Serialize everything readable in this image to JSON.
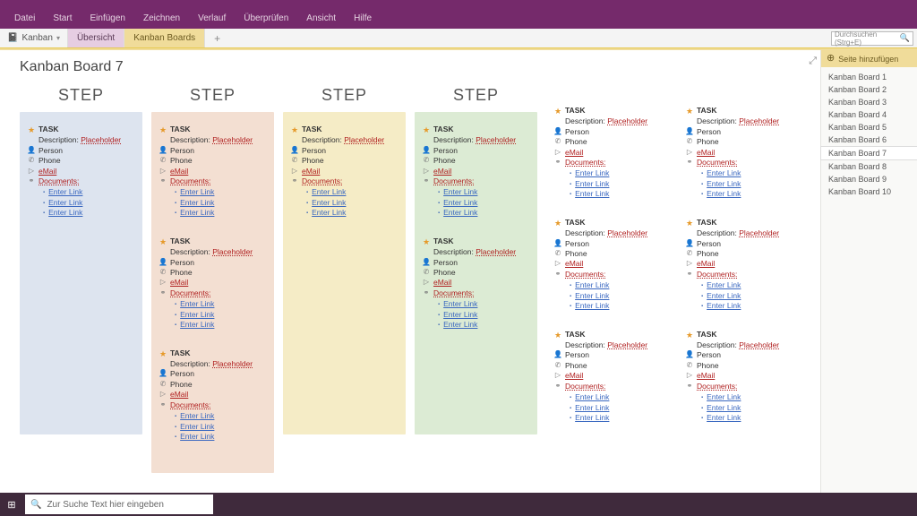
{
  "menu": {
    "items": [
      "Datei",
      "Start",
      "Einfügen",
      "Zeichnen",
      "Verlauf",
      "Überprüfen",
      "Ansicht",
      "Hilfe"
    ]
  },
  "notebook": {
    "name": "Kanban"
  },
  "sections": {
    "a": "Übersicht",
    "b": "Kanban Boards"
  },
  "search": {
    "placeholder": "Durchsuchen (Strg+E)"
  },
  "page": {
    "title": "Kanban Board 7"
  },
  "col_header": "STEP",
  "card": {
    "task": "TASK",
    "desc_label": "Description:",
    "desc_value": "Placeholder",
    "person": "Person",
    "phone": "Phone",
    "email": "eMail",
    "docs": "Documents:",
    "link": "Enter Link"
  },
  "columns": [
    {
      "cards": 1
    },
    {
      "cards": 3
    },
    {
      "cards": 1
    },
    {
      "cards": 2
    },
    {
      "cards": 3
    },
    {
      "cards": 3
    }
  ],
  "pagepanel": {
    "add": "Seite hinzufügen",
    "items": [
      "Kanban Board 1",
      "Kanban Board 2",
      "Kanban Board 3",
      "Kanban Board 4",
      "Kanban Board 5",
      "Kanban Board 6",
      "Kanban Board 7",
      "Kanban Board 8",
      "Kanban Board 9",
      "Kanban Board 10"
    ],
    "active": 6
  },
  "taskbar": {
    "search": "Zur Suche Text hier eingeben"
  }
}
